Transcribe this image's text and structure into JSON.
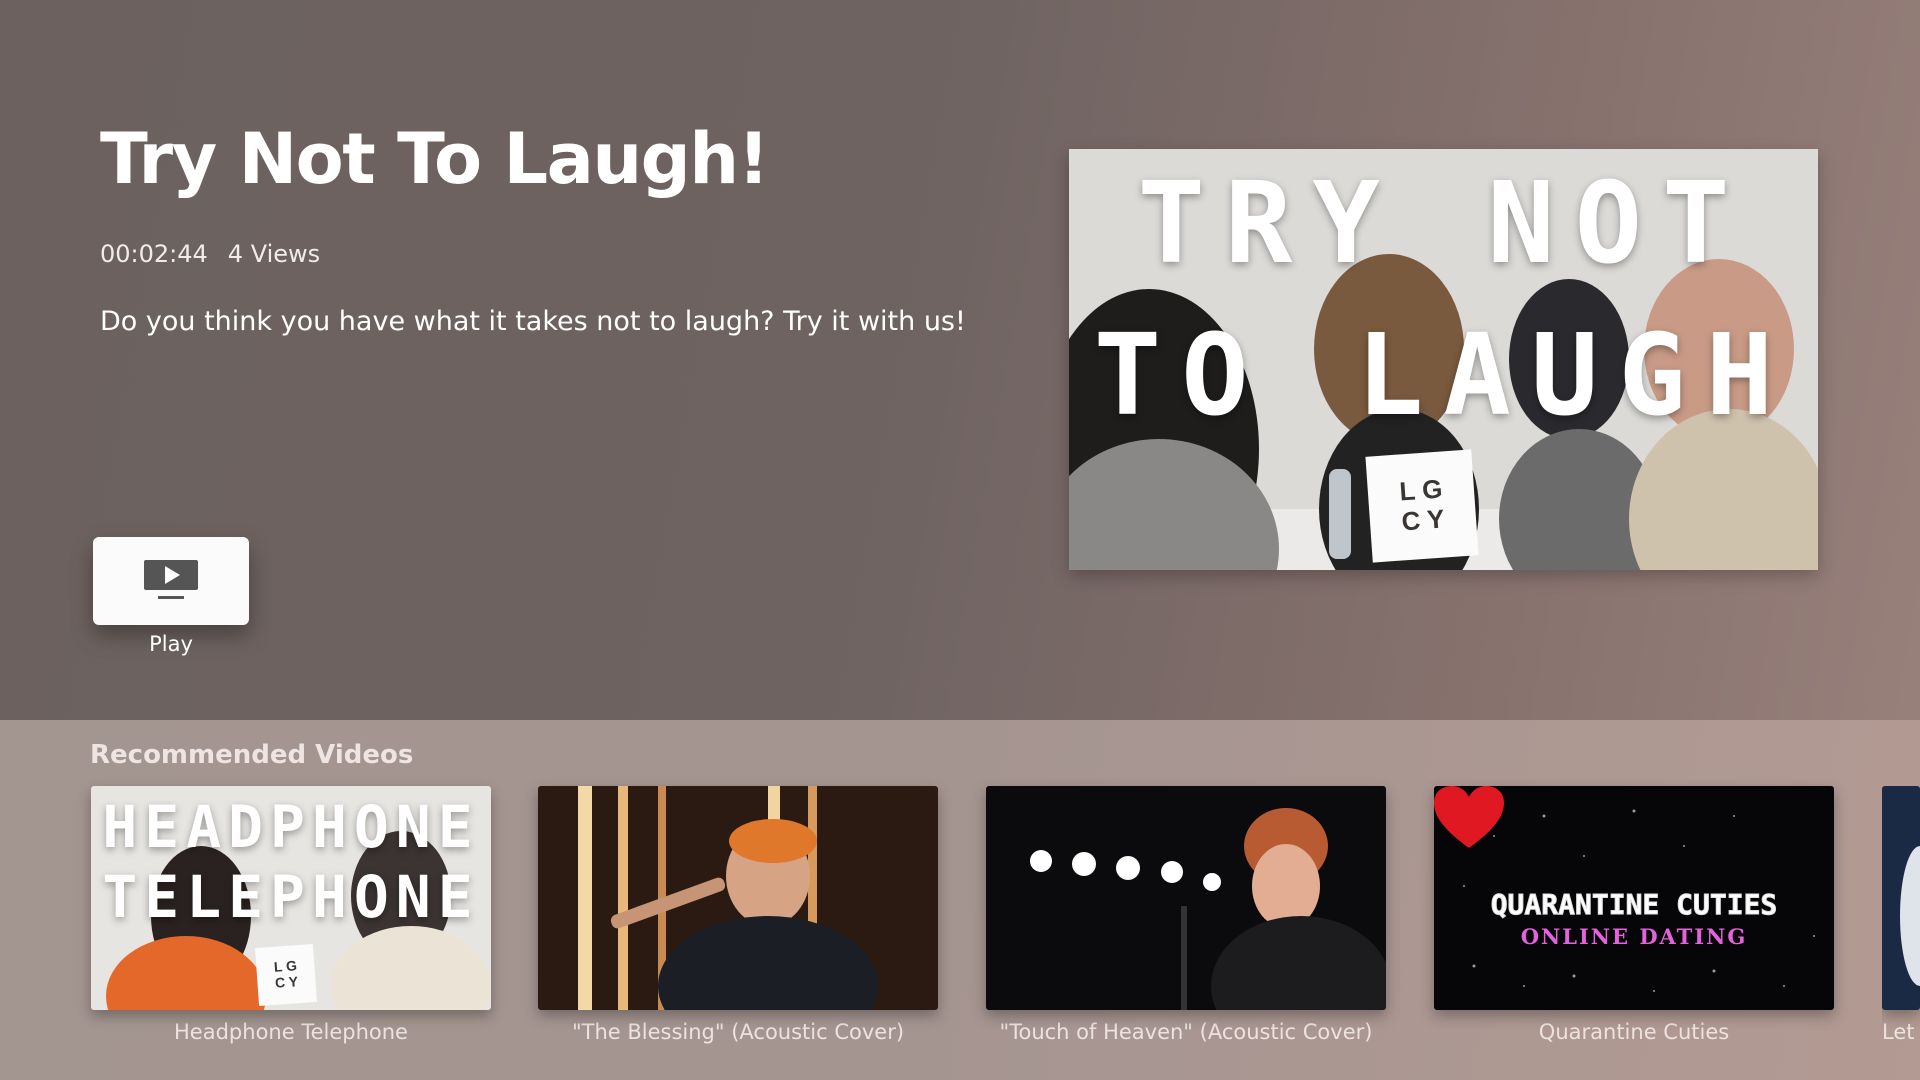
{
  "hero": {
    "title": "Try Not To Laugh!",
    "duration": "00:02:44",
    "views": "4 Views",
    "description": "Do you think you have what it takes not to laugh? Try it with us!",
    "play_label": "Play",
    "thumbnail": {
      "line1": "TRY NOT",
      "line2": "TO LAUGH",
      "logo_line1": "L G",
      "logo_line2": "C Y"
    }
  },
  "recommended": {
    "heading": "Recommended Videos",
    "items": [
      {
        "caption": "Headphone Telephone",
        "thumb_line1": "HEADPHONE",
        "thumb_line2": "TELEPHONE",
        "logo_line1": "L G",
        "logo_line2": "C Y"
      },
      {
        "caption": "\"The Blessing\" (Acoustic Cover)"
      },
      {
        "caption": "\"Touch of Heaven\" (Acoustic Cover)"
      },
      {
        "caption": "Quarantine Cuties",
        "thumb_line1": "QUARANTINE CUTIES",
        "thumb_line2": "ONLINE DATING"
      },
      {
        "caption": "Let"
      }
    ]
  },
  "colors": {
    "background": "#6e6361",
    "shelf": "#a59591",
    "button": "#fbfbfb",
    "accent_pink": "#e462dc",
    "heart_red": "#e01822"
  },
  "icons": [
    "play-icon",
    "heart-icon"
  ]
}
